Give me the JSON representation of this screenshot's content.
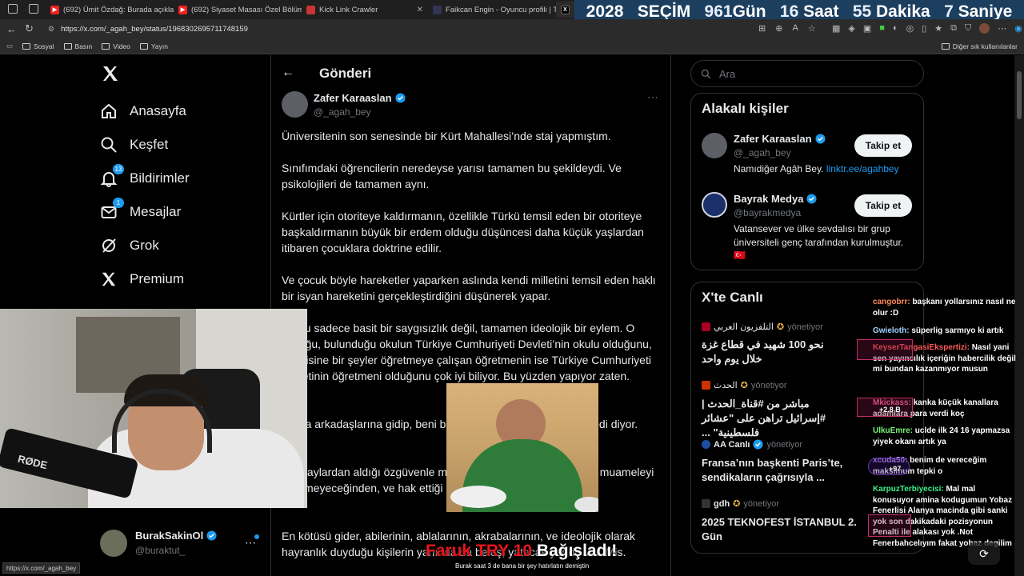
{
  "countdown": {
    "year": "2028",
    "label": "SEÇİM",
    "days": "961",
    "days_unit": "Gün",
    "hours": "16",
    "hours_unit": "Saat",
    "minutes": "55",
    "minutes_unit": "Dakika",
    "seconds": "7",
    "seconds_unit": "Saniye"
  },
  "tabs": [
    {
      "title": "(692) Ümit Özdağ: Burada açıklay...",
      "color": "#e22"
    },
    {
      "title": "(692) Siyaset Masası Özel Bölüm ...",
      "color": "#e22"
    },
    {
      "title": "Kick Link Crawler",
      "color": "#c33"
    },
    {
      "title": "Faikcan Engin - Oyuncu profili | T...",
      "color": "#335"
    },
    {
      "title": "X",
      "color": "#000"
    }
  ],
  "browser": {
    "url": "https://x.com/_agah_bey/status/1968302695711748159",
    "bookmarks": [
      "Sosyal",
      "Basın",
      "Video",
      "Yayın"
    ],
    "other_bookmarks": "Diğer sık kullanılanlar",
    "status_url": "https://x.com/_agah_bey"
  },
  "nav": {
    "items": [
      {
        "label": "Anasayfa",
        "icon": "home-icon"
      },
      {
        "label": "Keşfet",
        "icon": "search-icon"
      },
      {
        "label": "Bildirimler",
        "icon": "bell-icon",
        "badge": "13"
      },
      {
        "label": "Mesajlar",
        "icon": "mail-icon",
        "badge": "1"
      },
      {
        "label": "Grok",
        "icon": "grok-icon"
      },
      {
        "label": "Premium",
        "icon": "x-logo-icon"
      }
    ],
    "account": {
      "name": "BurakSakinOl",
      "handle": "@buraktut_"
    }
  },
  "post": {
    "header": "Gönderi",
    "author": {
      "name": "Zafer Karaaslan",
      "handle": "@_agah_bey"
    },
    "paragraphs": [
      "Üniversitenin son senesinde bir Kürt Mahallesi’nde staj yapmıştım.",
      "Sınıfımdaki öğrencilerin neredeyse yarısı tamamen bu şekildeydi. Ve psikolojileri de tamamen aynı.",
      "Kürtler için otoriteye kaldırmanın, özellikle Türkü temsil eden bir otoriteye başkaldırmanın büyük bir erdem olduğu düşüncesi daha küçük yaşlardan itibaren çocuklara doktrine edilir.",
      "Ve çocuk böyle hareketler yaparken aslında kendi milletini temsil eden haklı bir isyan hareketini gerçekleştirdiğini düşünerek yapar.",
      "Bu bu sadece basit bir saygısızlık değil, tamamen ideolojik bir eylem. O çocuğu, bulunduğu okulun Türkiye Cumhuriyeti Devleti’nin okulu olduğunu, kendisine bir şeyler öğretmeye çalışan öğretmenin ise Türkiye Cumhuriyeti devletinin öğretmeni olduğunu çok iyi biliyor. Bu yüzden yapıyor zaten.",
      "Sonra arkadaşlarına gidip, beni bana bir şey demeye götü yemedi diyor.",
      "Bu olaylardan aldığı özgüvenle motivasyonu elde ediyor. Çünkü muameleyi göremeyeceğinden, ve hak ettiği değerini bilmez.",
      "En kötüsü gider, abilerinin, ablalarının, akrabalarının, ve ideolojik olarak hayranlık duyduğu kişilerin yanında da beleş, yatacak yer de var. Mis."
    ]
  },
  "search": {
    "placeholder": "Ara"
  },
  "related": {
    "title": "Alakalı kişiler",
    "people": [
      {
        "name": "Zafer Karaaslan",
        "handle": "@_agah_bey",
        "bio": "Namıdiğer Agâh Bey.",
        "link": "linktr.ee/agahbey",
        "button": "Takip et"
      },
      {
        "name": "Bayrak Medya",
        "handle": "@bayrakmedya",
        "bio": "Vatansever ve ülke sevdalısı bir grup üniversiteli genç tarafından kurulmuştur. 🇹🇷",
        "button": "Takip et"
      }
    ]
  },
  "live": {
    "title": "X'te Canlı",
    "items": [
      {
        "source": "التلفزيون العربي",
        "role": "yönetiyor",
        "text": "نحو 100 شهيد في قطاع غزة خلال يوم واحد"
      },
      {
        "source": "الحدث",
        "role": "yönetiyor",
        "text": "مباشر من #قناة_الحدث | #إسرائيل تراهن على \"عشائر فلسطينية\" ..."
      },
      {
        "source": "AA Canlı",
        "role": "yönetiyor",
        "text": "Fransa’nın başkenti Paris’te, sendikaların çağrısıyla ..."
      },
      {
        "source": "gdh",
        "role": "yönetiyor",
        "text": "2025 TEKNOFEST İSTANBUL 2. Gün"
      }
    ]
  },
  "chat": [
    {
      "user": "cangobrr:",
      "msg": "başkanı yollarsınız nasıl ne olur :D"
    },
    {
      "user": "Gwieloth:",
      "msg": "süperlig sarmıyo ki artık"
    },
    {
      "user": "KeyserTangasiEkspertizi:",
      "msg": "Nasıl yani sen yayıncılık içeriğin habercilik değil mi bundan kazanmıyor musun"
    },
    {
      "user": "Mkickass:",
      "msg": "kanka küçük kanallara adamlara para verdi koç"
    },
    {
      "user": "UlkuEmre:",
      "msg": "uclde ilk 24 16 yapmazsa yiyek okanı artık ya"
    },
    {
      "user": "xcuda50:",
      "msg": "benim de vereceğim maksimum tepki o"
    },
    {
      "user": "KarpuzTerbiyecisi:",
      "msg": "Mal mal konusuyor amina kodugumun Yobaz Fenerlisi Alanya macinda gibi sanki yok son dakikadaki pozisyonun Penalti ile alakası yok .Not Fenerbahcelıyım fakat yobaz degilim"
    }
  ],
  "chat_badges": [
    "+2.8 B",
    "+97"
  ],
  "donation": {
    "name": "Faruk TRY 10",
    "text": "Bağışladı!",
    "caption": "Burak saat 3 de bana bir şey hatırlatın demiştin"
  },
  "webcam": {
    "mic_brand": "RØDE"
  }
}
